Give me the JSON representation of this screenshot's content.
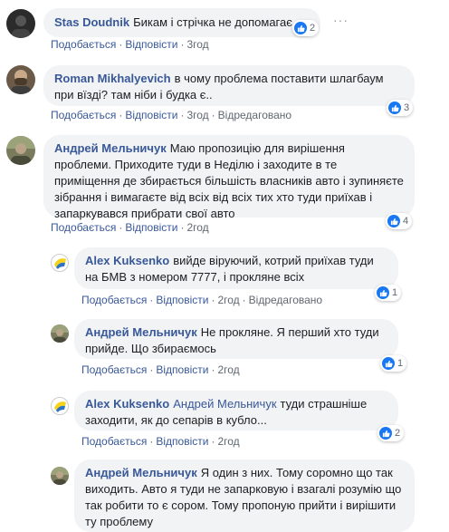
{
  "comments": [
    {
      "author": "Stas Doudnik",
      "text": "Бикам і стрічка не допомагає.",
      "like": "Подобається",
      "reply": "Відповісти",
      "time": "3год",
      "edited": "",
      "reactions": "2",
      "more": "···"
    },
    {
      "author": "Roman Mikhalyevich",
      "text": "в чому проблема поставити шлагбаум при вїзді? там ніби і будка є..",
      "like": "Подобається",
      "reply": "Відповісти",
      "time": "3год",
      "edited": "Відредаговано",
      "reactions": "3"
    },
    {
      "author": "Андрей Мельничук",
      "text": "Маю пропозицію для вирішення проблеми. Приходите туди в Неділю і заходите в те приміщення де збирається більшість власників авто і зупиняєте зібрання і вимагаєте від всіх від всіх тих хто туди приїхав і запаркувався прибрати свої авто",
      "like": "Подобається",
      "reply": "Відповісти",
      "time": "2год",
      "edited": "",
      "reactions": "4"
    },
    {
      "author": "Alex Kuksenko",
      "text": "вийде віруючий, котрий приїхав туди на БМВ з номером 7777, і прокляне всіх",
      "like": "Подобається",
      "reply": "Відповісти",
      "time": "2год",
      "edited": "Відредаговано",
      "reactions": "1"
    },
    {
      "author": "Андрей Мельничук",
      "text": "Не прокляне. Я перший хто туди прийде. Що збираємось",
      "like": "Подобається",
      "reply": "Відповісти",
      "time": "2год",
      "edited": "",
      "reactions": "1"
    },
    {
      "author": "Alex Kuksenko",
      "mention": "Андрей Мельничук",
      "text": "туди страшніше заходити, як до сепарів в кубло...",
      "like": "Подобається",
      "reply": "Відповісти",
      "time": "2год",
      "edited": "",
      "reactions": "2"
    },
    {
      "author": "Андрей Мельничук",
      "text": "Я один з них. Тому соромно що так виходить. Авто я туди не запарковую і взагалі розумію що так робити то є сором. Тому пропоную прийти і вирішити ту проблему",
      "like": "",
      "reply": "",
      "time": "",
      "edited": "",
      "reactions": ""
    }
  ],
  "colors": {
    "link": "#385898",
    "bubble": "#f2f3f5",
    "like_blue": "#1877f2"
  },
  "icons": {
    "like": "thumbs-up-icon",
    "more": "more-options-icon"
  }
}
